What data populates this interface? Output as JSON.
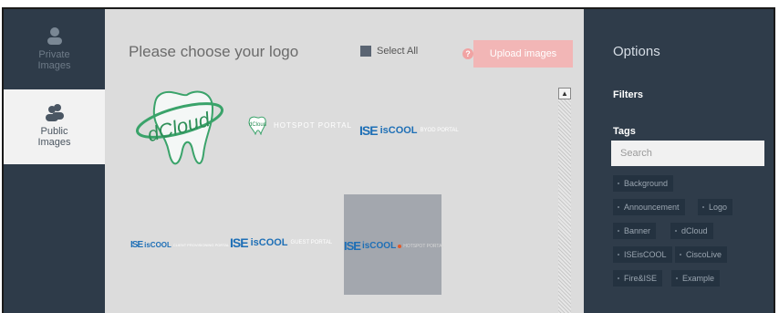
{
  "nav": {
    "private": {
      "line1": "Private",
      "line2": "Images"
    },
    "public": {
      "line1": "Public",
      "line2": "Images"
    }
  },
  "main": {
    "title": "Please choose your logo",
    "select_all": "Select All",
    "help": "?",
    "upload": "Upload images",
    "logos": [
      {
        "text": "dCloud"
      },
      {
        "badge": "dCloud",
        "text": "HOTSPOT PORTAL"
      },
      {
        "brand": "ISE",
        "brand2": "isCOOL",
        "text": "BYOD PORTAL"
      },
      {
        "brand": "ISE",
        "brand2": "isCOOL",
        "text": "CLIENT PROVISIONING PORTAL"
      },
      {
        "brand": "ISE",
        "brand2": "isCOOL",
        "text": "GUEST PORTAL"
      },
      {
        "brand": "ISE",
        "brand2": "isCOOL",
        "text": "HOTSPOT PORTAL"
      }
    ]
  },
  "options": {
    "title": "Options",
    "filters": "Filters",
    "tags_label": "Tags",
    "search_placeholder": "Search",
    "tags": [
      "Background",
      "Announcement",
      "Logo",
      "Banner",
      "dCloud",
      "ISEisCOOL",
      "CiscoLive",
      "Fire&ISE",
      "Example"
    ]
  },
  "colors": {
    "dark_bg": "#2f3c4a",
    "upload_btn": "#f2b6b6",
    "main_bg": "#dcdcdc"
  }
}
